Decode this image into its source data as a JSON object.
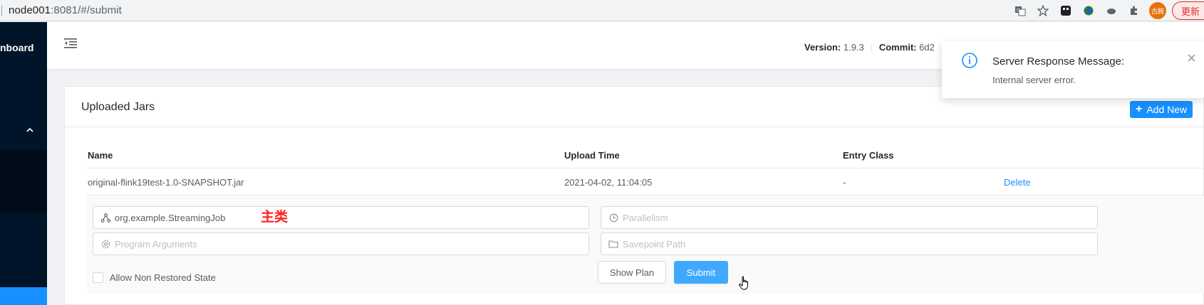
{
  "browser": {
    "url_host": "node001",
    "url_path": ":8081/#/submit",
    "profile_label": "古腾",
    "update_label": "更新"
  },
  "sidebar": {
    "title_fragment": "nboard"
  },
  "header": {
    "version_label": "Version:",
    "version_value": "1.9.3",
    "commit_label": "Commit:",
    "commit_value": "6d2"
  },
  "card": {
    "title": "Uploaded Jars",
    "add_new_label": "Add New"
  },
  "table": {
    "columns": [
      "Name",
      "Upload Time",
      "Entry Class"
    ],
    "rows": [
      {
        "name": "original-flink19test-1.0-SNAPSHOT.jar",
        "upload_time": "2021-04-02, 11:04:05",
        "entry_class": "-",
        "action": "Delete"
      }
    ]
  },
  "submit_form": {
    "entry_class_value": "org.example.StreamingJob",
    "entry_annotation": "主类",
    "parallelism_placeholder": "Parallelism",
    "program_args_placeholder": "Program Arguments",
    "savepoint_placeholder": "Savepoint Path",
    "allow_non_restored_label": "Allow Non Restored State",
    "show_plan_label": "Show Plan",
    "submit_label": "Submit"
  },
  "notification": {
    "title": "Server Response Message:",
    "description": "Internal server error."
  },
  "colors": {
    "primary": "#1890ff",
    "sidebar": "#001529",
    "annotation": "#ff2020"
  }
}
